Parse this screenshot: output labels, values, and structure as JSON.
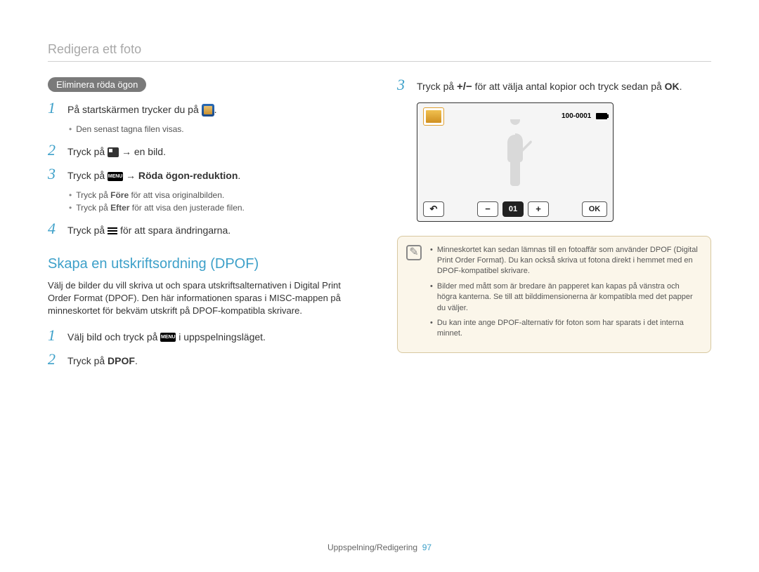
{
  "page_title": "Redigera ett foto",
  "pill_label": "Eliminera röda ögon",
  "left_steps": [
    {
      "num": "1",
      "pre": "På startskärmen trycker du på ",
      "post": "."
    },
    {
      "num": "2",
      "pre": "Tryck på ",
      "mid": " → en bild."
    },
    {
      "num": "3",
      "pre": "Tryck på ",
      "mid_bold": " → Röda ögon-reduktion",
      "post": "."
    },
    {
      "num": "4",
      "pre": "Tryck på ",
      "mid": " för att spara ändringarna."
    }
  ],
  "left_sub1": [
    "Den senast tagna filen visas."
  ],
  "left_sub3": [
    {
      "pre": "Tryck på ",
      "bold1": "Före",
      "post": " för att visa originalbilden."
    },
    {
      "pre": "Tryck på ",
      "bold1": "Efter",
      "post": " för att visa den justerade filen."
    }
  ],
  "section": {
    "title": "Skapa en utskriftsordning (DPOF)",
    "desc": "Välj de bilder du vill skriva ut och spara utskriftsalternativen i Digital Print Order Format (DPOF). Den här informationen sparas i MISC-mappen på minneskortet för bekväm utskrift på DPOF-kompatibla skrivare."
  },
  "dpof_steps": [
    {
      "num": "1",
      "pre": "Välj bild och tryck på ",
      "post": " i uppspelningsläget."
    },
    {
      "num": "2",
      "pre": "Tryck på ",
      "bold": "DPOF",
      "post": "."
    }
  ],
  "right_step": {
    "num": "3",
    "pre": "Tryck på ",
    "mid": " för att välja antal kopior och tryck sedan på ",
    "ok": "OK",
    "post": "."
  },
  "screen": {
    "counter": "100-0001",
    "copies": "01",
    "ok": "OK",
    "plus": "+",
    "minus": "−",
    "back": "↶"
  },
  "menu_label": "MENU",
  "plusminus": "+/−",
  "note_items": [
    "Minneskortet kan sedan lämnas till en fotoaffär som använder DPOF (Digital Print Order Format). Du kan också skriva ut fotona direkt i hemmet med en DPOF-kompatibel skrivare.",
    "Bilder med mått som är bredare än papperet kan kapas på vänstra och högra kanterna. Se till att bilddimensionerna är kompatibla med det papper du väljer.",
    "Du kan inte ange DPOF-alternativ för foton som har sparats i det interna minnet."
  ],
  "footer": {
    "section": "Uppspelning/Redigering",
    "page": "97"
  }
}
